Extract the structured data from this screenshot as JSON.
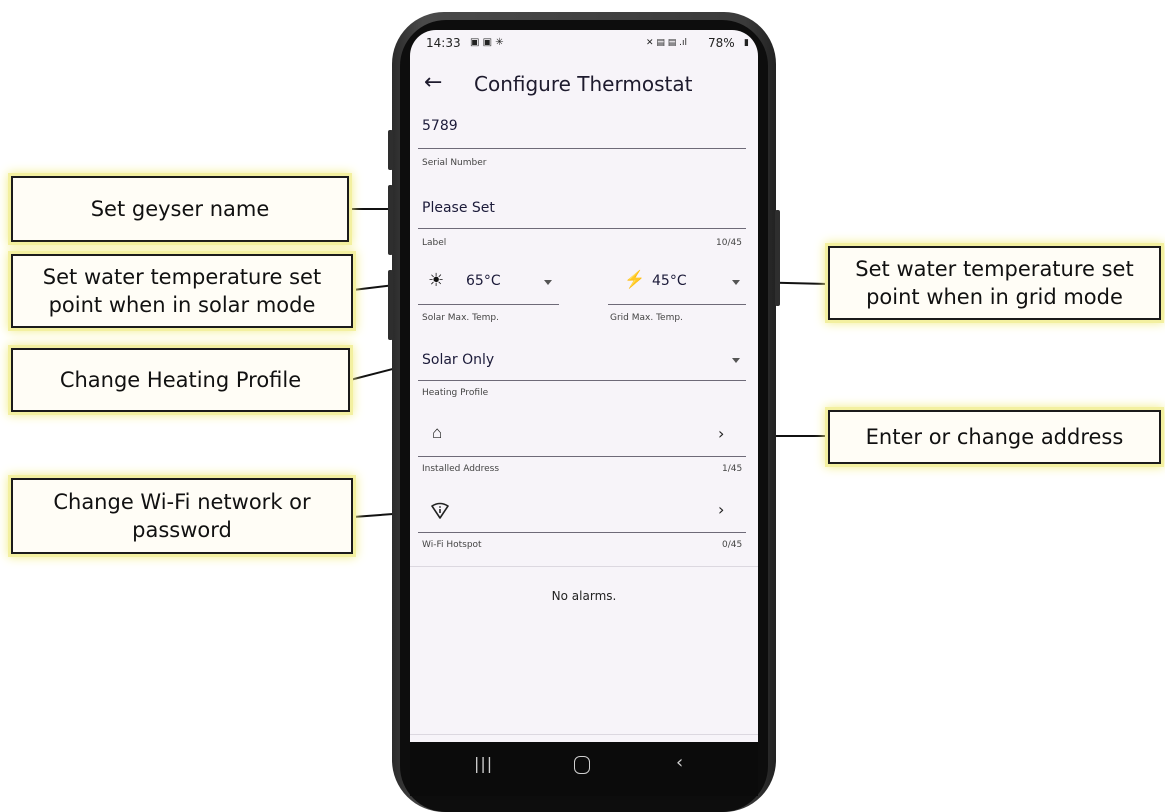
{
  "callouts": {
    "geyser_name": "Set geyser name",
    "solar_setpoint": "Set water temperature set point when in solar mode",
    "grid_setpoint": "Set water temperature set point when in grid mode",
    "heating_profile": "Change Heating Profile",
    "address": "Enter or change address",
    "wifi": "Change Wi-Fi network or password"
  },
  "status_bar": {
    "time": "14:33",
    "battery": "78%"
  },
  "app_bar": {
    "title": "Configure Thermostat"
  },
  "form": {
    "serial": {
      "value": "5789",
      "label": "Serial Number"
    },
    "name": {
      "value": "Please Set",
      "label": "Label",
      "counter": "10/45"
    },
    "solar_temp": {
      "value": "65°C",
      "label": "Solar Max. Temp."
    },
    "grid_temp": {
      "value": "45°C",
      "label": "Grid Max. Temp."
    },
    "heating_profile": {
      "value": "Solar Only",
      "label": "Heating Profile"
    },
    "address": {
      "label": "Installed Address",
      "counter": "1/45"
    },
    "wifi": {
      "label": "Wi-Fi Hotspot",
      "counter": "0/45"
    }
  },
  "alarms": {
    "text": "No alarms."
  },
  "icons": [
    "back-arrow-icon",
    "sun-icon",
    "bolt-icon",
    "home-icon",
    "wifi-icon",
    "chevron-right-icon",
    "dropdown-arrow-icon",
    "nav-recents-icon",
    "nav-home-icon",
    "nav-back-icon"
  ],
  "colors": {
    "screen_bg": "#f7f4f9",
    "callout_glow": "#f2ee8a",
    "text_primary": "#1c1b3a"
  }
}
